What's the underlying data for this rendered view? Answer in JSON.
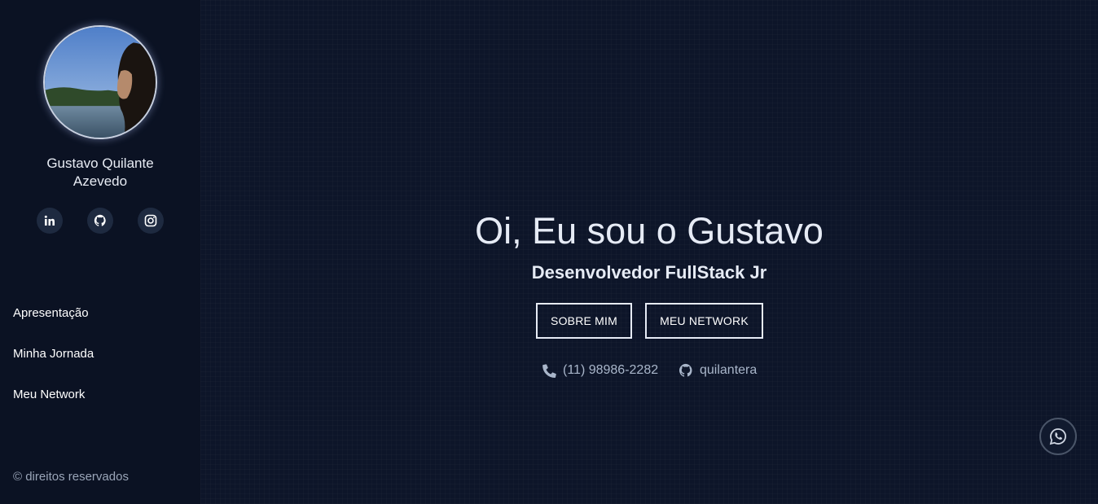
{
  "profile": {
    "name_line1": "Gustavo Quilante",
    "name_line2": "Azevedo",
    "avatar_icon": "profile-photo"
  },
  "socials": [
    {
      "name": "linkedin",
      "icon": "linkedin-icon"
    },
    {
      "name": "github",
      "icon": "github-icon"
    },
    {
      "name": "instagram",
      "icon": "instagram-icon"
    }
  ],
  "nav": {
    "items": [
      {
        "label": "Apresentação"
      },
      {
        "label": "Minha Jornada"
      },
      {
        "label": "Meu Network"
      }
    ]
  },
  "footer": {
    "copyright": "© direitos reservados"
  },
  "hero": {
    "title": "Oi, Eu sou o Gustavo",
    "subtitle": "Desenvolvedor FullStack Jr",
    "buttons": [
      {
        "label": "SOBRE MIM"
      },
      {
        "label": "MEU NETWORK"
      }
    ],
    "contacts": [
      {
        "icon": "phone-icon",
        "text": "(11) 98986-2282"
      },
      {
        "icon": "github-icon",
        "text": "quilantera"
      }
    ]
  },
  "floating": {
    "whatsapp_icon": "whatsapp-icon"
  },
  "colors": {
    "background": "#0d1529",
    "sidebar": "#0b1223",
    "text": "#e6ebf5",
    "muted": "#a9b6ca",
    "social_bg": "#1e2a40"
  }
}
